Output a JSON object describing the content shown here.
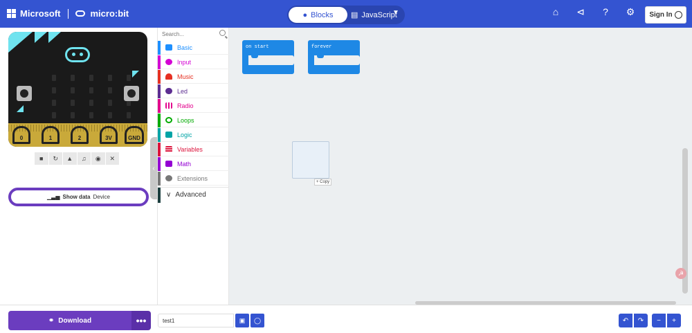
{
  "header": {
    "brand": "Microsoft",
    "product": "micro:bit",
    "blocks_tab": "Blocks",
    "javascript_tab": "JavaScript",
    "sign_in": "Sign In",
    "colors": {
      "bar": "#3454d1"
    }
  },
  "simulator": {
    "pins": [
      "0",
      "1",
      "2",
      "3V",
      "GND"
    ],
    "show_data": "Show data",
    "device": "Device",
    "controls": [
      "stop",
      "restart",
      "slowmo",
      "audio",
      "screenshot",
      "close"
    ]
  },
  "toolbox": {
    "search_placeholder": "Search...",
    "categories": [
      {
        "label": "Basic",
        "color": "#1e90ff"
      },
      {
        "label": "Input",
        "color": "#d400d4"
      },
      {
        "label": "Music",
        "color": "#e63022"
      },
      {
        "label": "Led",
        "color": "#5c2d91"
      },
      {
        "label": "Radio",
        "color": "#e3008c"
      },
      {
        "label": "Loops",
        "color": "#00aa00"
      },
      {
        "label": "Logic",
        "color": "#00a4a6"
      },
      {
        "label": "Variables",
        "color": "#dc143c"
      },
      {
        "label": "Math",
        "color": "#9400d3"
      },
      {
        "label": "Extensions",
        "color": "#777777"
      }
    ],
    "advanced": "Advanced"
  },
  "workspace": {
    "block_on_start": "on start",
    "block_forever": "forever",
    "copy_tag": "+ Copy"
  },
  "bottom": {
    "download": "Download",
    "more": "•••",
    "project_name": "test1"
  }
}
